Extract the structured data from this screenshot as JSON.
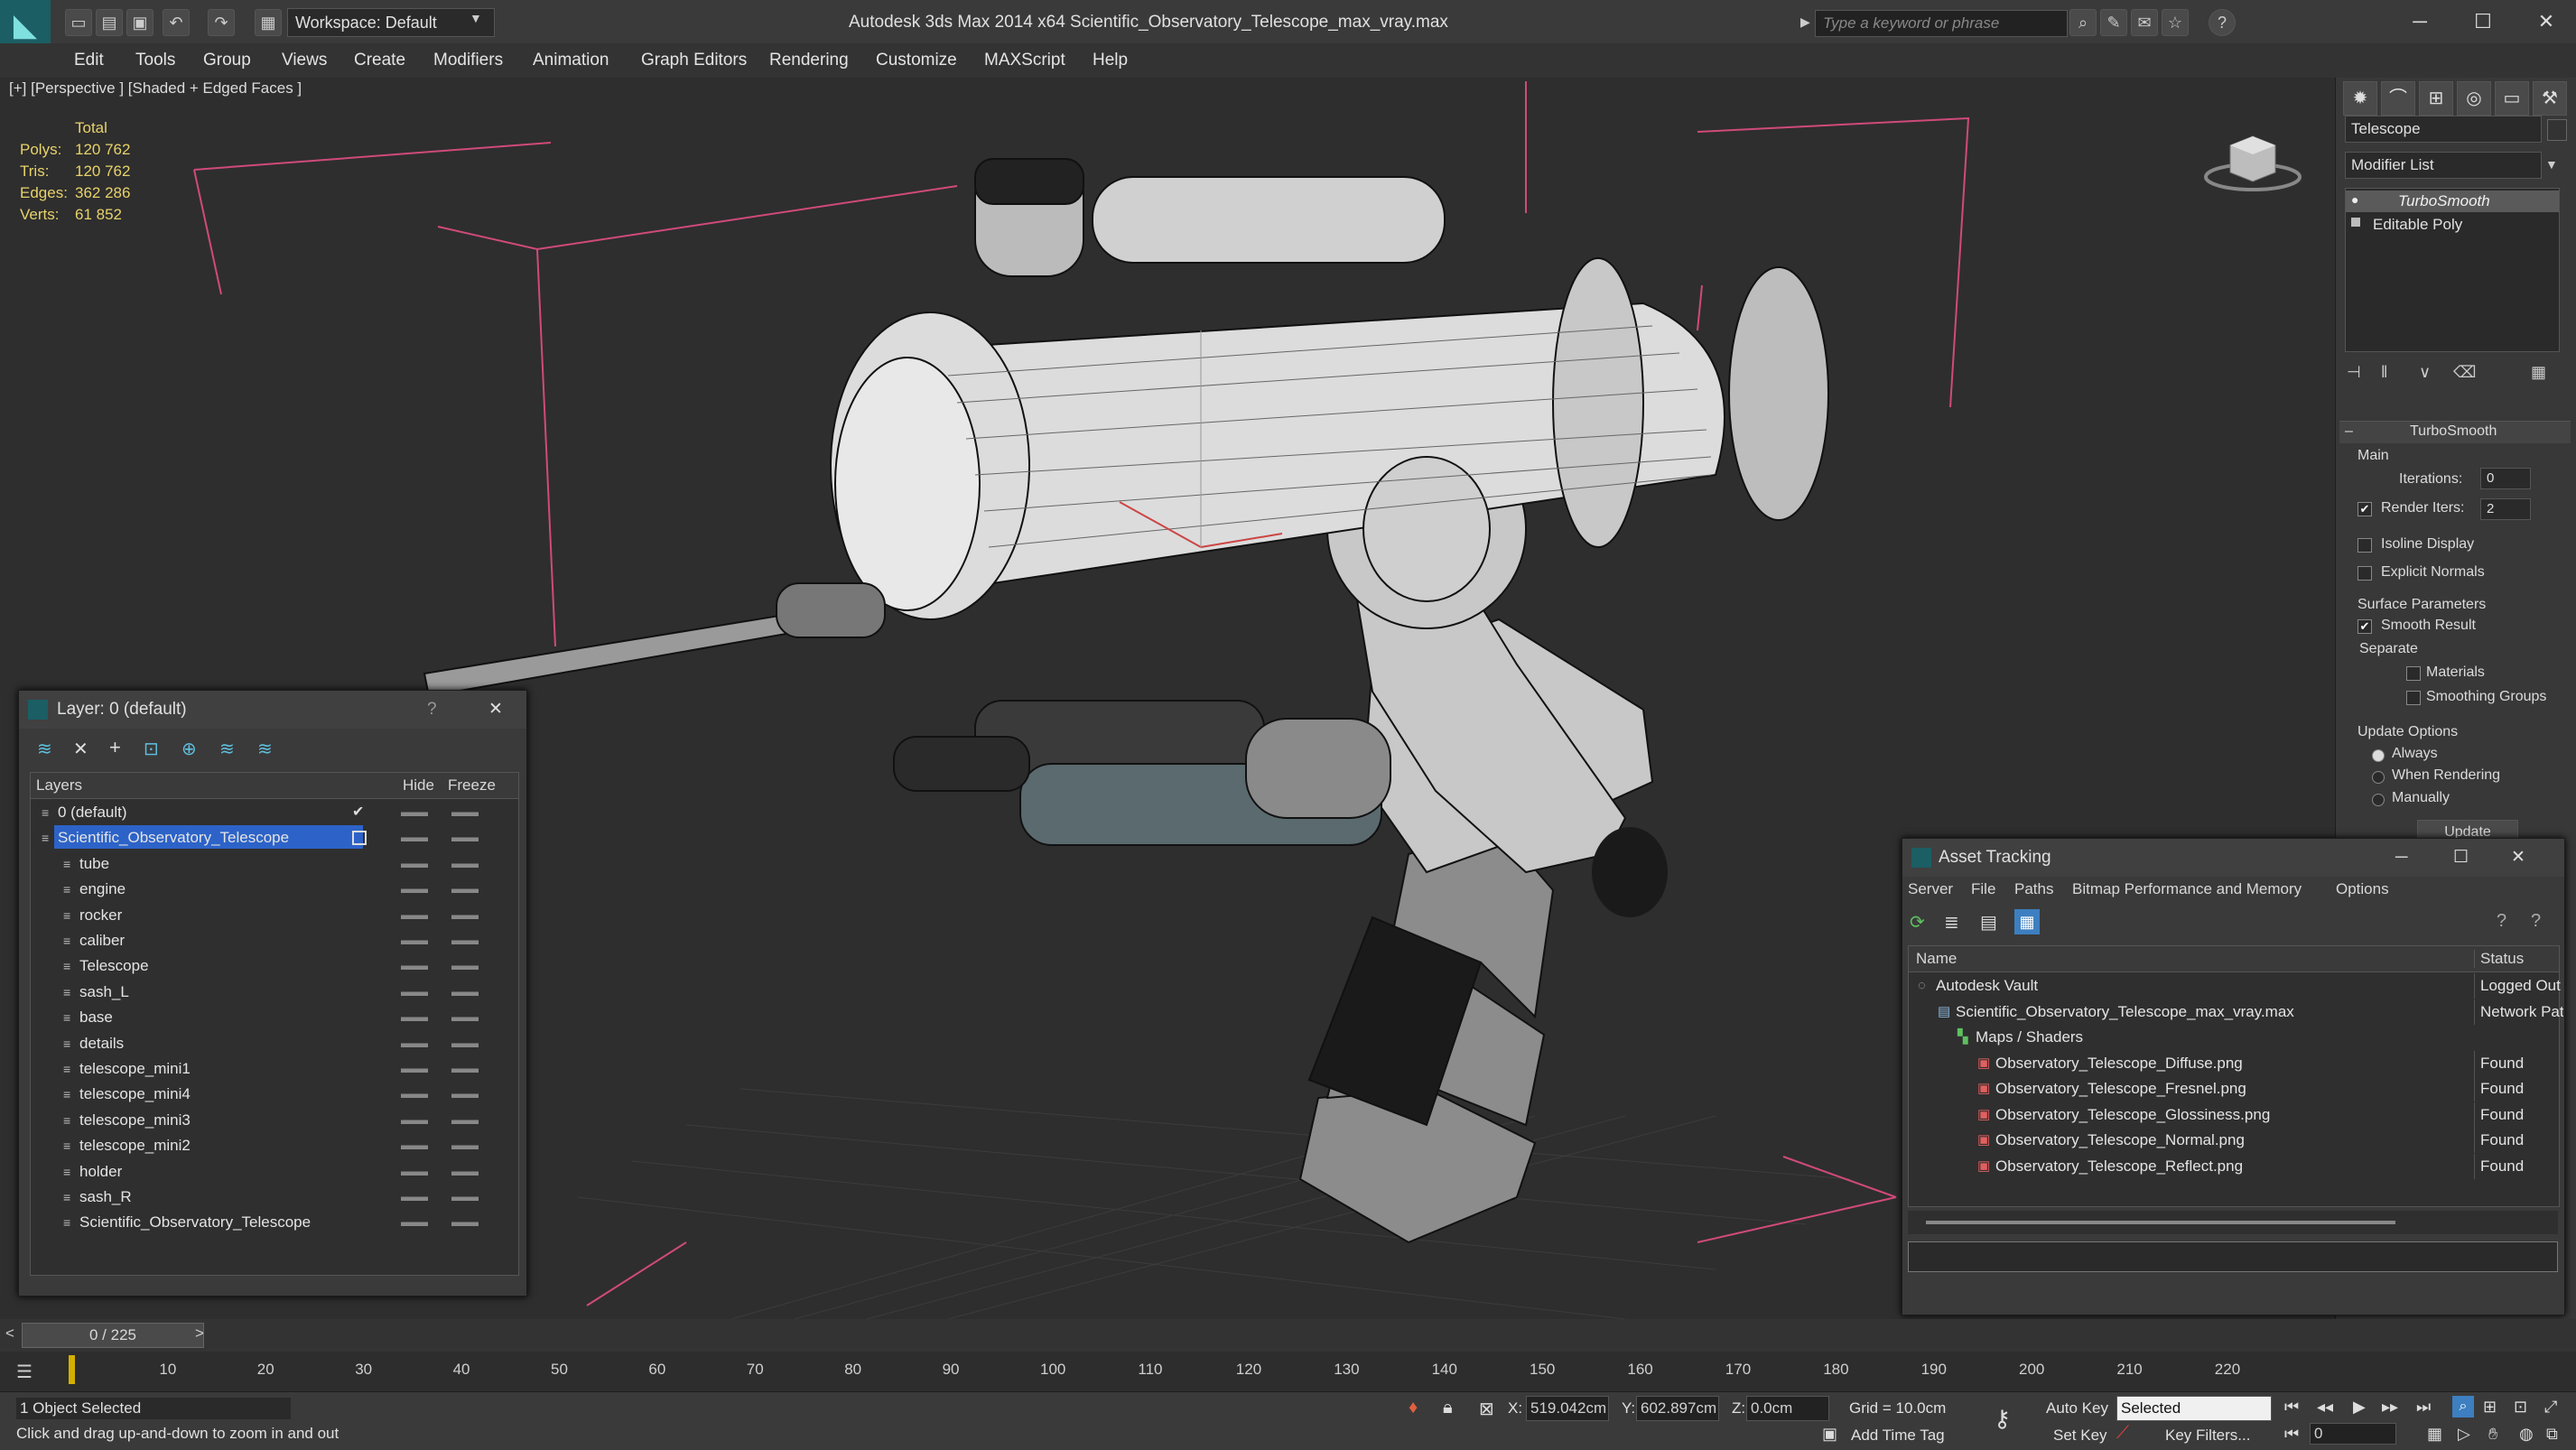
{
  "window": {
    "title": "Autodesk 3ds Max  2014 x64      Scientific_Observatory_Telescope_max_vray.max",
    "workspace": "Workspace: Default",
    "search_placeholder": "Type a keyword or phrase"
  },
  "menu": [
    "Edit",
    "Tools",
    "Group",
    "Views",
    "Create",
    "Modifiers",
    "Animation",
    "Graph Editors",
    "Rendering",
    "Customize",
    "MAXScript",
    "Help"
  ],
  "viewport": {
    "label": "[+] [Perspective ] [Shaded + Edged Faces ]",
    "stats": {
      "header": "Total",
      "rows": [
        {
          "label": "Polys:",
          "value": "120 762"
        },
        {
          "label": "Tris:",
          "value": "120 762"
        },
        {
          "label": "Edges:",
          "value": "362 286"
        },
        {
          "label": "Verts:",
          "value": "61 852"
        }
      ]
    }
  },
  "command_panel": {
    "object_name": "Telescope",
    "modifier_list": "Modifier List",
    "stack": [
      "TurboSmooth",
      "Editable Poly"
    ],
    "rollout_title": "TurboSmooth",
    "main_label": "Main",
    "iterations_label": "Iterations:",
    "iterations_value": "0",
    "render_iters_label": "Render Iters:",
    "render_iters_value": "2",
    "isoline_display": "Isoline Display",
    "explicit_normals": "Explicit Normals",
    "surface_parameters": "Surface Parameters",
    "smooth_result": "Smooth Result",
    "separate": "Separate",
    "materials": "Materials",
    "smoothing_groups": "Smoothing Groups",
    "update_options": "Update Options",
    "always": "Always",
    "when_rendering": "When Rendering",
    "manually": "Manually",
    "update_button": "Update"
  },
  "layer_dialog": {
    "title": "Layer: 0 (default)",
    "help": "?",
    "close": "✕",
    "col_layers": "Layers",
    "col_hide": "Hide",
    "col_freeze": "Freeze",
    "layers": [
      {
        "name": "0 (default)",
        "level": 0,
        "selected": false
      },
      {
        "name": "Scientific_Observatory_Telescope",
        "level": 0,
        "selected": true
      },
      {
        "name": "tube",
        "level": 1,
        "selected": false
      },
      {
        "name": "engine",
        "level": 1,
        "selected": false
      },
      {
        "name": "rocker",
        "level": 1,
        "selected": false
      },
      {
        "name": "caliber",
        "level": 1,
        "selected": false
      },
      {
        "name": "Telescope",
        "level": 1,
        "selected": false
      },
      {
        "name": "sash_L",
        "level": 1,
        "selected": false
      },
      {
        "name": "base",
        "level": 1,
        "selected": false
      },
      {
        "name": "details",
        "level": 1,
        "selected": false
      },
      {
        "name": "telescope_mini1",
        "level": 1,
        "selected": false
      },
      {
        "name": "telescope_mini4",
        "level": 1,
        "selected": false
      },
      {
        "name": "telescope_mini3",
        "level": 1,
        "selected": false
      },
      {
        "name": "telescope_mini2",
        "level": 1,
        "selected": false
      },
      {
        "name": "holder",
        "level": 1,
        "selected": false
      },
      {
        "name": "sash_R",
        "level": 1,
        "selected": false
      },
      {
        "name": "Scientific_Observatory_Telescope",
        "level": 1,
        "selected": false
      }
    ]
  },
  "asset_dialog": {
    "title": "Asset Tracking",
    "menu": [
      "Server",
      "File",
      "Paths",
      "Bitmap Performance and Memory",
      "Options"
    ],
    "col_name": "Name",
    "col_status": "Status",
    "rows": [
      {
        "name": "Autodesk Vault",
        "status": "Logged Out",
        "level": 0
      },
      {
        "name": "Scientific_Observatory_Telescope_max_vray.max",
        "status": "Network Pat",
        "level": 1
      },
      {
        "name": "Maps / Shaders",
        "status": "",
        "level": 2
      },
      {
        "name": "Observatory_Telescope_Diffuse.png",
        "status": "Found",
        "level": 3
      },
      {
        "name": "Observatory_Telescope_Fresnel.png",
        "status": "Found",
        "level": 3
      },
      {
        "name": "Observatory_Telescope_Glossiness.png",
        "status": "Found",
        "level": 3
      },
      {
        "name": "Observatory_Telescope_Normal.png",
        "status": "Found",
        "level": 3
      },
      {
        "name": "Observatory_Telescope_Reflect.png",
        "status": "Found",
        "level": 3
      }
    ]
  },
  "timeline": {
    "frame": "0 / 225",
    "ticks": [
      "10",
      "20",
      "30",
      "40",
      "50",
      "60",
      "70",
      "80",
      "90",
      "100",
      "110",
      "120",
      "130",
      "140",
      "150",
      "160",
      "170",
      "180",
      "190",
      "200",
      "210",
      "220"
    ]
  },
  "status": {
    "selected": "1 Object Selected",
    "hint": "Click and drag up-and-down to zoom in and out",
    "x_label": "X:",
    "x_value": "519.042cm",
    "y_label": "Y:",
    "y_value": "602.897cm",
    "z_label": "Z:",
    "z_value": "0.0cm",
    "grid": "Grid = 10.0cm",
    "auto_key": "Auto Key",
    "selected_dropdown": "Selected",
    "set_key": "Set Key",
    "key_filters": "Key Filters...",
    "add_time_tag": "Add Time Tag",
    "frame_value": "0"
  }
}
